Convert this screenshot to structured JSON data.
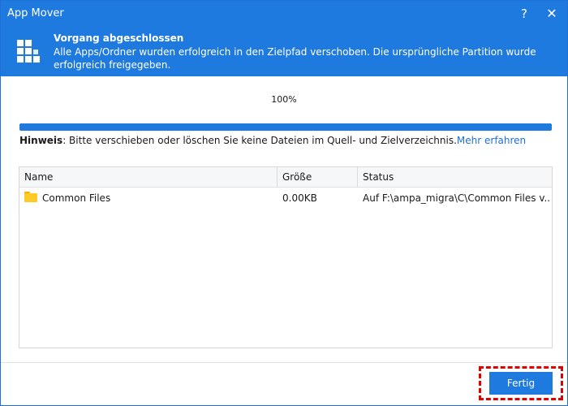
{
  "window": {
    "title": "App Mover",
    "help_label": "?",
    "close_label": "✕"
  },
  "banner": {
    "title": "Vorgang abgeschlossen",
    "message": "Alle Apps/Ordner wurden erfolgreich in den Zielpfad verschoben. Die ursprüngliche Partition wurde erfolgreich freigegeben."
  },
  "progress": {
    "percent_text": "100%",
    "value": 1.0
  },
  "hint": {
    "label": "Hinweis",
    "text": ": Bitte verschieben oder löschen Sie keine Dateien im Quell- und Zielverzeichnis.",
    "link": "Mehr erfahren"
  },
  "table": {
    "columns": [
      "Name",
      "Größe",
      "Status"
    ],
    "rows": [
      {
        "icon": "folder-icon",
        "name": "Common Files",
        "size": "0.00KB",
        "status": "Auf F:\\ampa_migra\\C\\Common Files v..."
      }
    ]
  },
  "footer": {
    "done_label": "Fertig"
  },
  "colors": {
    "accent": "#1f7ae0",
    "highlight": "#e00000",
    "folder": "#ffca28"
  }
}
